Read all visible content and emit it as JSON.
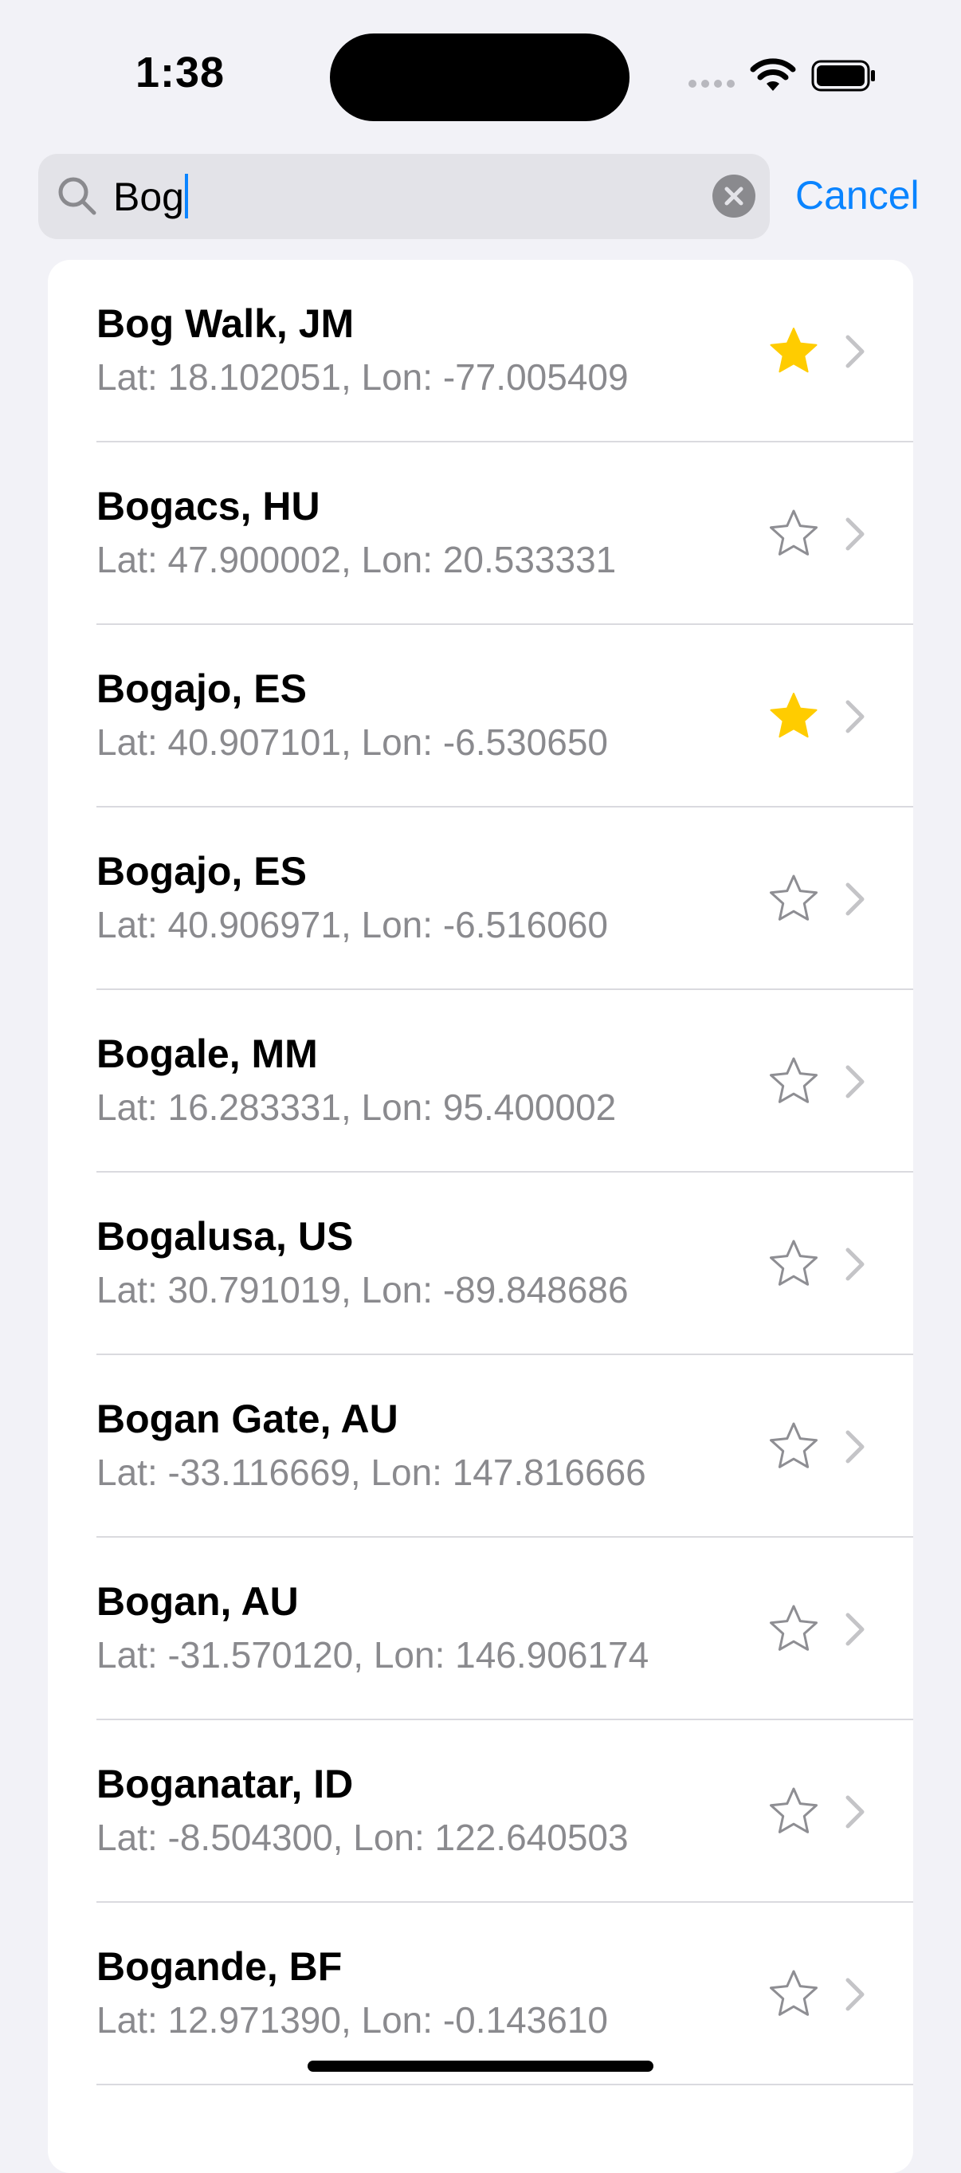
{
  "status_bar": {
    "time": "1:38"
  },
  "search": {
    "value": "Bog"
  },
  "cancel_label": "Cancel",
  "colors": {
    "accent": "#0A84FF",
    "favorite": "#FFCC00",
    "unfavorite": "#8E8E93"
  },
  "results": [
    {
      "title": "Bog Walk, JM",
      "subtitle": "Lat: 18.102051, Lon: -77.005409",
      "favorite": true
    },
    {
      "title": "Bogacs, HU",
      "subtitle": "Lat: 47.900002, Lon: 20.533331",
      "favorite": false
    },
    {
      "title": "Bogajo, ES",
      "subtitle": "Lat: 40.907101, Lon: -6.530650",
      "favorite": true
    },
    {
      "title": "Bogajo, ES",
      "subtitle": "Lat: 40.906971, Lon: -6.516060",
      "favorite": false
    },
    {
      "title": "Bogale, MM",
      "subtitle": "Lat: 16.283331, Lon: 95.400002",
      "favorite": false
    },
    {
      "title": "Bogalusa, US",
      "subtitle": "Lat: 30.791019, Lon: -89.848686",
      "favorite": false
    },
    {
      "title": "Bogan Gate, AU",
      "subtitle": "Lat: -33.116669, Lon: 147.816666",
      "favorite": false
    },
    {
      "title": "Bogan, AU",
      "subtitle": "Lat: -31.570120, Lon: 146.906174",
      "favorite": false
    },
    {
      "title": "Boganatar, ID",
      "subtitle": "Lat: -8.504300, Lon: 122.640503",
      "favorite": false
    },
    {
      "title": "Bogande, BF",
      "subtitle": "Lat: 12.971390, Lon: -0.143610",
      "favorite": false
    }
  ]
}
